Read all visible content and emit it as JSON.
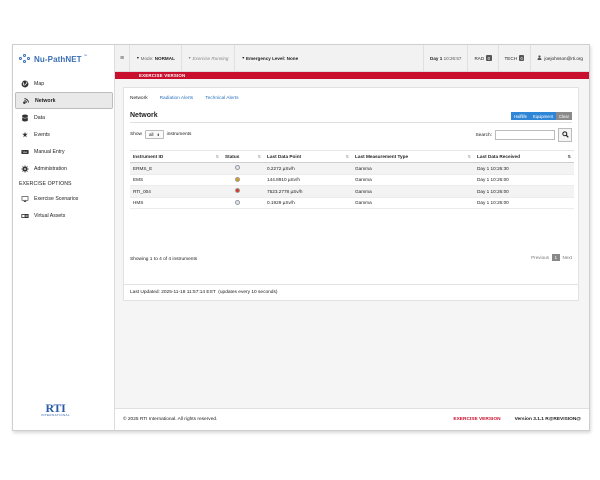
{
  "app": {
    "logo_text": "Nu-PathNET",
    "logo_tm": "™"
  },
  "sidebar": {
    "items": [
      {
        "label": "Map",
        "icon": "globe-icon",
        "active": false
      },
      {
        "label": "Network",
        "icon": "network-icon",
        "active": true
      },
      {
        "label": "Data",
        "icon": "database-icon",
        "active": false
      },
      {
        "label": "Events",
        "icon": "events-icon",
        "active": false
      },
      {
        "label": "Manual Entry",
        "icon": "keyboard-icon",
        "active": false
      },
      {
        "label": "Administration",
        "icon": "gear-icon",
        "active": false
      }
    ],
    "section_heading": "EXERCISE OPTIONS",
    "exercise_items": [
      {
        "label": "Exercise Scenarios",
        "icon": "monitor-icon"
      },
      {
        "label": "Virtual Assets",
        "icon": "assets-icon"
      }
    ],
    "brand": {
      "big": "RTI",
      "sub": "INTERNATIONAL"
    }
  },
  "topbar": {
    "menu_glyph": "≡",
    "mode_label": "Mode:",
    "mode_value": "NORMAL",
    "exercise_status": "Exercise Running",
    "emergency_label": "Emergency Level:",
    "emergency_value": "None",
    "day_label": "Day 1",
    "time": "10:26:57",
    "rad_label": "RAD",
    "rad_count": "0",
    "tech_label": "TECH",
    "tech_count": "0",
    "user": "joejohnson@rti.org"
  },
  "banner": {
    "text": "EXERCISE VERSION"
  },
  "tabs": [
    {
      "label": "Network",
      "active": true
    },
    {
      "label": "Radiation Alerts",
      "active": false
    },
    {
      "label": "Technical Alerts",
      "active": false
    }
  ],
  "panel": {
    "title": "Network",
    "buttons": {
      "halflife": "Halflife",
      "equipment": "Equipment",
      "clear": "Clear"
    },
    "show_label": "Show",
    "show_value": "all",
    "show_suffix": "instruments",
    "search_label": "Search:",
    "search_value": ""
  },
  "table": {
    "headers": [
      "Instrument ID",
      "Status",
      "Last Data Point",
      "Last Measurement Type",
      "Last Data Received"
    ],
    "rows": [
      {
        "id": "ERMS_E",
        "status_color": "#dce8f7",
        "data_point": "0.2272 µSv/h",
        "type": "Gamma",
        "received": "Day 1 10:26:30"
      },
      {
        "id": "EMS",
        "status_color": "#d9a21b",
        "data_point": "144.8910 µSv/h",
        "type": "Gamma",
        "received": "Day 1 10:26:00"
      },
      {
        "id": "RTI_004",
        "status_color": "#d9361e",
        "data_point": "7523.2778 µSv/h",
        "type": "Gamma",
        "received": "Day 1 10:26:00"
      },
      {
        "id": "HMS",
        "status_color": "#dce8f7",
        "data_point": "0.1929 µSv/h",
        "type": "Gamma",
        "received": "Day 1 10:26:00"
      }
    ],
    "info": "Showing 1 to 4 of 4 instruments",
    "pager": {
      "previous": "Previous",
      "current": "1",
      "next": "Next"
    }
  },
  "updated": {
    "text": "Last Updated: 2025-11-18 11:57:14 EST  (updates every 10 seconds)"
  },
  "footer": {
    "copyright": "© 2025 RTI International. All rights reserved.",
    "exercise": "EXERCISE VERSION",
    "version": "Version 3.1.1 R@REVISION@"
  }
}
